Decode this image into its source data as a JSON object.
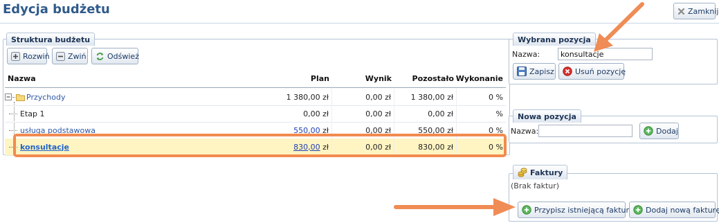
{
  "header": {
    "title": "Edycja budżetu",
    "close_label": "Zamknij"
  },
  "structure": {
    "legend": "Struktura budżetu",
    "toolbar": {
      "expand": "Rozwiń",
      "collapse": "Zwiń",
      "refresh": "Odśwież"
    },
    "columns": [
      "Nazwa",
      "Plan",
      "Wynik",
      "Pozostało",
      "Wykonanie"
    ],
    "rows": [
      {
        "name": "Przychody",
        "plan": "1 380,00",
        "plan_unit": "zł",
        "wynik": "0,00 zł",
        "pozostalo": "1 380,00 zł",
        "wykonanie": "0 %"
      },
      {
        "name": "Etap 1",
        "plan": "0,00",
        "plan_unit": "zł",
        "wynik": "0,00 zł",
        "pozostalo": "0,00 zł",
        "wykonanie": "%"
      },
      {
        "name": "usługa podstawowa",
        "plan": "550,00",
        "plan_unit": "zł",
        "wynik": "0,00 zł",
        "pozostalo": "550,00 zł",
        "wykonanie": "0 %"
      },
      {
        "name": "konsultacje",
        "plan": "830,00",
        "plan_unit": "zł",
        "wynik": "0,00 zł",
        "pozostalo": "830,00 zł",
        "wykonanie": "0 %"
      }
    ]
  },
  "selected": {
    "legend": "Wybrana pozycja",
    "name_label": "Nazwa:",
    "name_value": "konsultacje",
    "save_label": "Zapisz",
    "delete_label": "Usuń pozycję"
  },
  "new_item": {
    "legend": "Nowa pozycja",
    "name_label": "Nazwa:",
    "name_value": "",
    "add_label": "Dodaj"
  },
  "invoices": {
    "legend": "Faktury",
    "empty_text": "(Brak faktur)",
    "assign_label": "Przypisz istniejącą fakturę",
    "add_new_label": "Dodaj nową fakturę"
  },
  "colors": {
    "accent": "#2f5a8a",
    "annotation": "#f28b50",
    "selected_row": "#fff5c2"
  }
}
